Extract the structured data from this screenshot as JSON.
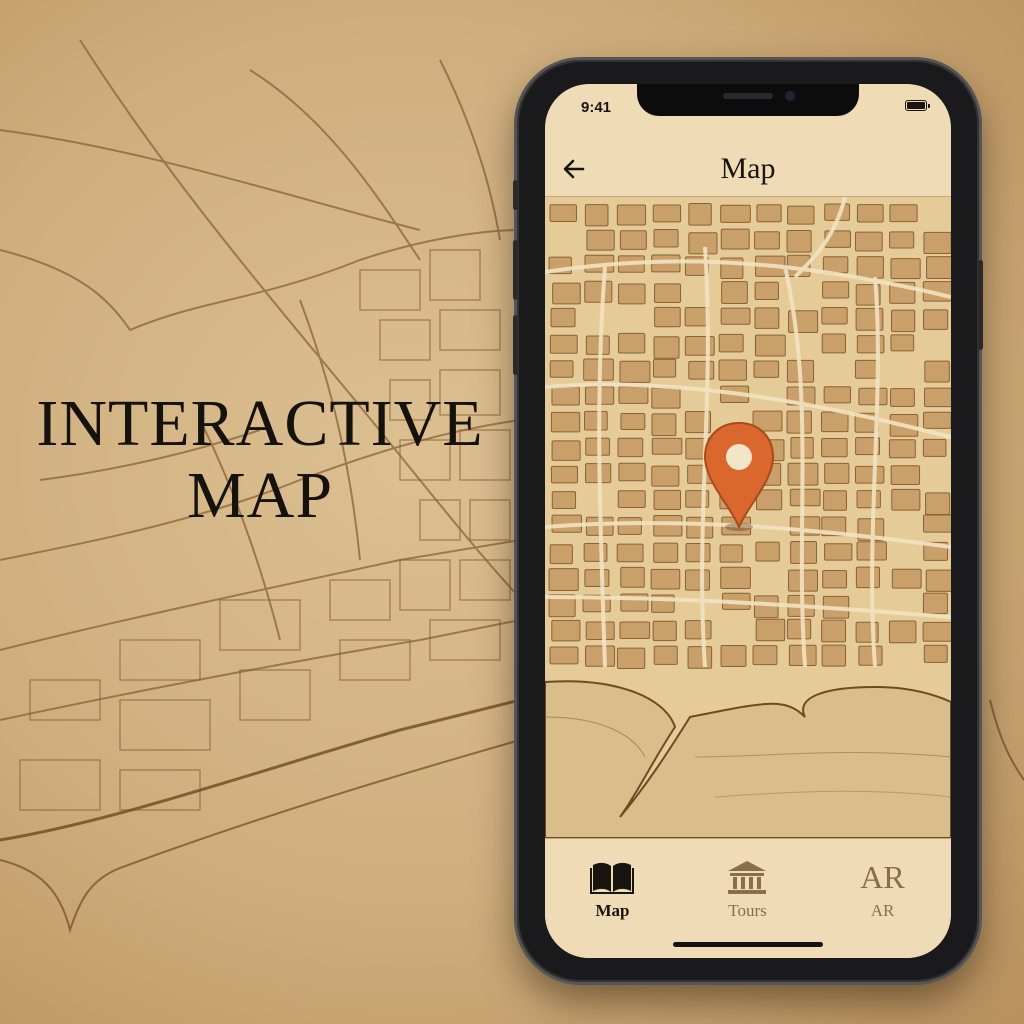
{
  "hero": {
    "line1": "INTERACTIVE",
    "line2": "MAP"
  },
  "status_bar": {
    "time": "9:41"
  },
  "header": {
    "title": "Map",
    "back_icon": "arrow-left-icon"
  },
  "map": {
    "marker_icon": "location-pin-icon",
    "marker_color": "#d9672e"
  },
  "tabs": [
    {
      "label": "Map",
      "icon": "book-icon",
      "active": true
    },
    {
      "label": "Tours",
      "icon": "museum-icon",
      "active": false
    },
    {
      "label": "AR",
      "icon_text": "AR",
      "active": false
    }
  ],
  "colors": {
    "parchment": "#efdcb6",
    "ink": "#1a1410",
    "inactive": "#8a6e4c",
    "map_line": "#8a6236"
  }
}
